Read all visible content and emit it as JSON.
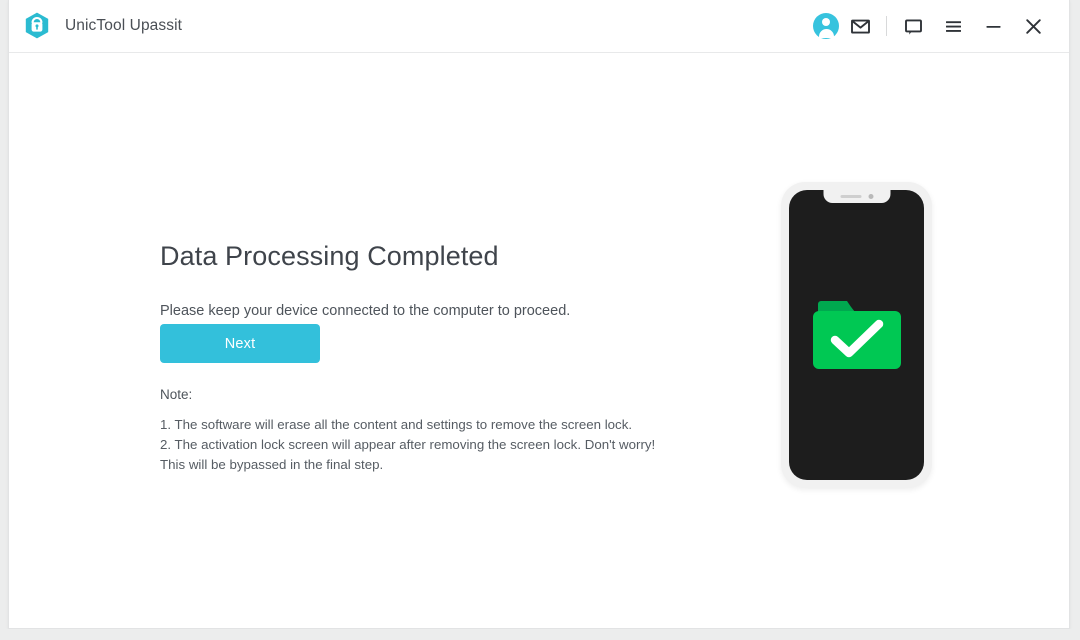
{
  "window": {
    "title": "UnicTool Upassit",
    "logo_icon": "shield-lock-icon",
    "accent_color": "#33c0db",
    "logo_color": "#2bbbd1"
  },
  "titlebar": {
    "icons": [
      {
        "name": "account-avatar-icon",
        "glyph": "avatar"
      },
      {
        "name": "mail-icon",
        "glyph": "envelope"
      },
      {
        "name": "feedback-icon",
        "glyph": "speech-bubble"
      },
      {
        "name": "menu-icon",
        "glyph": "hamburger"
      },
      {
        "name": "minimize-icon",
        "glyph": "minus"
      },
      {
        "name": "close-icon",
        "glyph": "cross"
      }
    ]
  },
  "main": {
    "headline": "Data Processing Completed",
    "subtext": "Please keep your device connected to the computer to proceed.",
    "next_label": "Next",
    "note_label": "Note:",
    "notes": [
      "1. The software will erase all the content and settings to remove the screen lock.",
      "2. The activation lock screen will appear after removing the screen lock. Don't worry! This will be bypassed in the final step."
    ]
  },
  "illustration": {
    "device": "smartphone-with-notch",
    "screen_color": "#1d1d1d",
    "frame_color": "#f1f1f1",
    "content_icon": "folder-check-icon",
    "folder_color": "#00c853",
    "folder_tab_color": "#00a94f",
    "check_color": "#ffffff"
  }
}
